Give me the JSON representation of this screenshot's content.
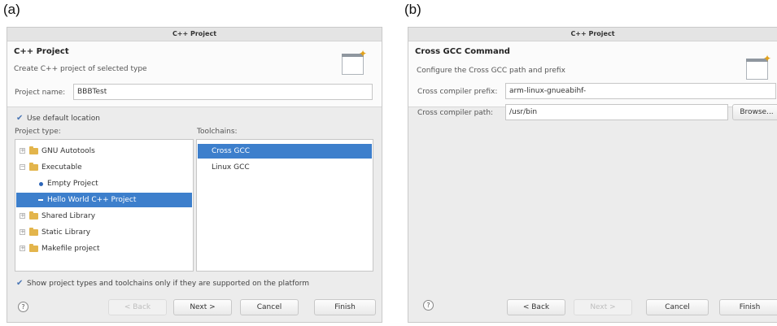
{
  "panel_a": {
    "label": "(a)",
    "window_title": "C++ Project",
    "header_title": "C++ Project",
    "header_desc": "Create C++ project of selected type",
    "project_name_label": "Project name:",
    "project_name_value": "BBBTest",
    "use_default_location": {
      "checked": true,
      "label": "Use default location"
    },
    "project_type_label": "Project type:",
    "toolchains_label": "Toolchains:",
    "project_types": [
      {
        "label": "GNU Autotools",
        "kind": "folder"
      },
      {
        "label": "Executable",
        "kind": "folder"
      },
      {
        "label": "Empty Project",
        "kind": "leaf"
      },
      {
        "label": "Hello World C++ Project",
        "kind": "leaf",
        "selected": true
      },
      {
        "label": "Shared Library",
        "kind": "folder"
      },
      {
        "label": "Static Library",
        "kind": "folder"
      },
      {
        "label": "Makefile project",
        "kind": "folder"
      }
    ],
    "toolchains": [
      {
        "label": "Cross GCC",
        "selected": true
      },
      {
        "label": "Linux GCC",
        "selected": false
      }
    ],
    "show_supported": {
      "checked": true,
      "label": "Show project types and toolchains only if they are supported on the platform"
    },
    "buttons": {
      "help": "?",
      "back": "< Back",
      "next": "Next >",
      "cancel": "Cancel",
      "finish": "Finish"
    }
  },
  "panel_b": {
    "label": "(b)",
    "window_title": "C++ Project",
    "header_title": "Cross GCC Command",
    "header_desc": "Configure the Cross GCC path and prefix",
    "prefix_label": "Cross compiler prefix:",
    "prefix_value": "arm-linux-gnueabihf-",
    "path_label": "Cross compiler path:",
    "path_value": "/usr/bin",
    "browse": "Browse...",
    "buttons": {
      "help": "?",
      "back": "< Back",
      "next": "Next >",
      "cancel": "Cancel",
      "finish": "Finish"
    }
  },
  "colors": {
    "selection": "#3d7fcc",
    "folder": "#e3b54c",
    "checkmark": "#4a76b5"
  }
}
